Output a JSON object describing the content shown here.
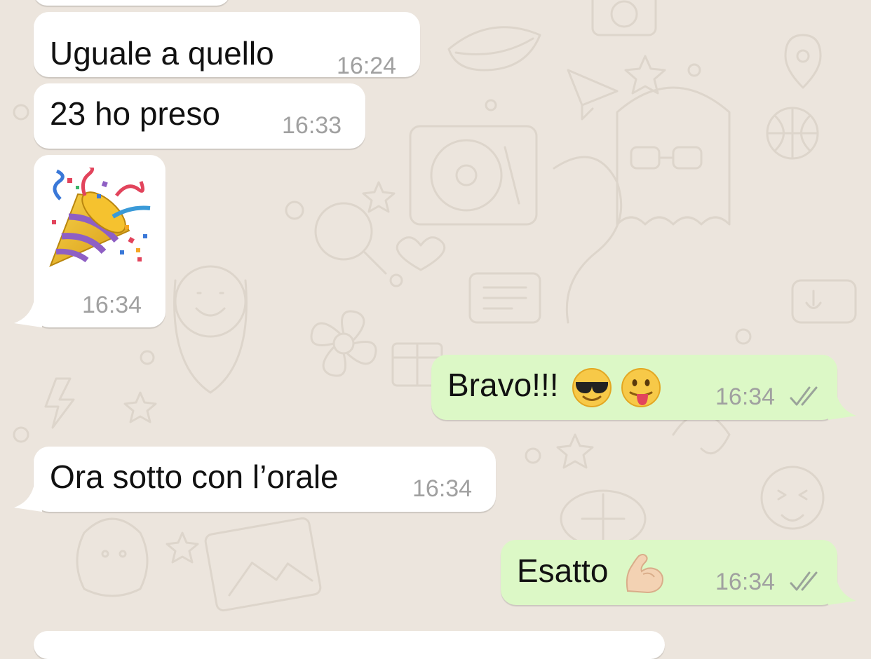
{
  "messages": [
    {
      "direction": "in",
      "text": "Uguale a quello",
      "time": "16:24"
    },
    {
      "direction": "in",
      "text": "23 ho preso",
      "time": "16:33"
    },
    {
      "direction": "in",
      "emoji": "party-popper-icon",
      "time": "16:34"
    },
    {
      "direction": "out",
      "text": "Bravo!!!",
      "emojis": [
        "sunglasses-face-icon",
        "tongue-face-icon"
      ],
      "time": "16:34",
      "status": "read"
    },
    {
      "direction": "in",
      "text": "Ora sotto con l’orale",
      "time": "16:34"
    },
    {
      "direction": "out",
      "text": "Esatto",
      "emojis": [
        "flexed-biceps-icon"
      ],
      "time": "16:34",
      "status": "read"
    }
  ],
  "colors": {
    "wallpaper": "#ece5dd",
    "incoming_bubble": "#ffffff",
    "outgoing_bubble": "#dcf8c6",
    "timestamp": "#a0a0a0",
    "text": "#111111"
  }
}
